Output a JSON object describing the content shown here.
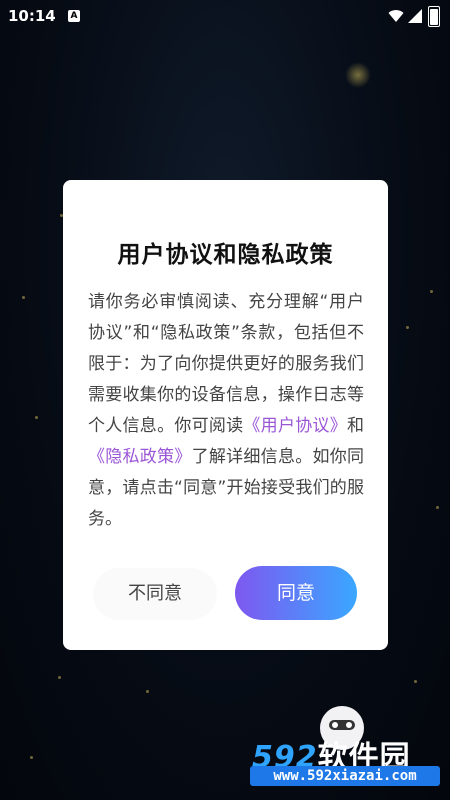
{
  "status_bar": {
    "time": "10:14",
    "notification_glyph": "A",
    "icons": [
      "wifi-icon",
      "signal-icon",
      "battery-icon"
    ]
  },
  "dialog": {
    "title": "用户协议和隐私政策",
    "body": {
      "text_1": "请你务必审慎阅读、充分理解“用户协议”和“隐私政策”条款，包括但不限于：为了向你提供更好的服务我们需要收集你的设备信息，操作日志等个人信息。你可阅读",
      "link_user_agreement": "《用户协议》",
      "text_2": "和",
      "link_privacy_policy": "《隐私政策》",
      "text_3": "了解详细信息。如你同意，请点击“同意”开始接受我们的服务。"
    },
    "disagree_label": "不同意",
    "agree_label": "同意"
  },
  "colors": {
    "link": "#9b56d6",
    "agree_gradient_start": "#7e58f0",
    "agree_gradient_end": "#3aa7ff"
  },
  "watermark": {
    "logo_number": "592",
    "logo_text": "软件园",
    "url": "www.592xiazai.com"
  }
}
